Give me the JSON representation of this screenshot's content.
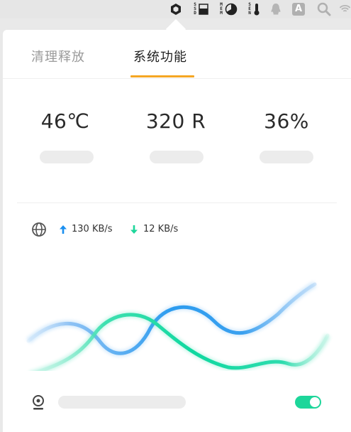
{
  "menubar": {
    "icons": [
      "hexagon-nut-icon",
      "ssd-icon",
      "memory-icon",
      "sensor-icon",
      "qq-icon",
      "input-method-icon",
      "search-icon",
      "wifi-icon"
    ],
    "ssd_label": "SSD",
    "mem_label": "MEM",
    "sen_label": "SEN",
    "input_method_label": "A"
  },
  "tabs": [
    {
      "label": "清理释放",
      "active": false
    },
    {
      "label": "系统功能",
      "active": true
    }
  ],
  "stats": {
    "temperature": "46℃",
    "fan_speed": "320 R",
    "cpu_usage": "36%"
  },
  "network": {
    "upload": "130 KB/s",
    "download": "12 KB/s"
  },
  "webcam_toggle": {
    "on": true
  },
  "colors": {
    "accent": "#f5a623",
    "upload_arrow": "#1a8ff0",
    "download_arrow": "#1dd69a",
    "toggle_on": "#1dd69a"
  }
}
